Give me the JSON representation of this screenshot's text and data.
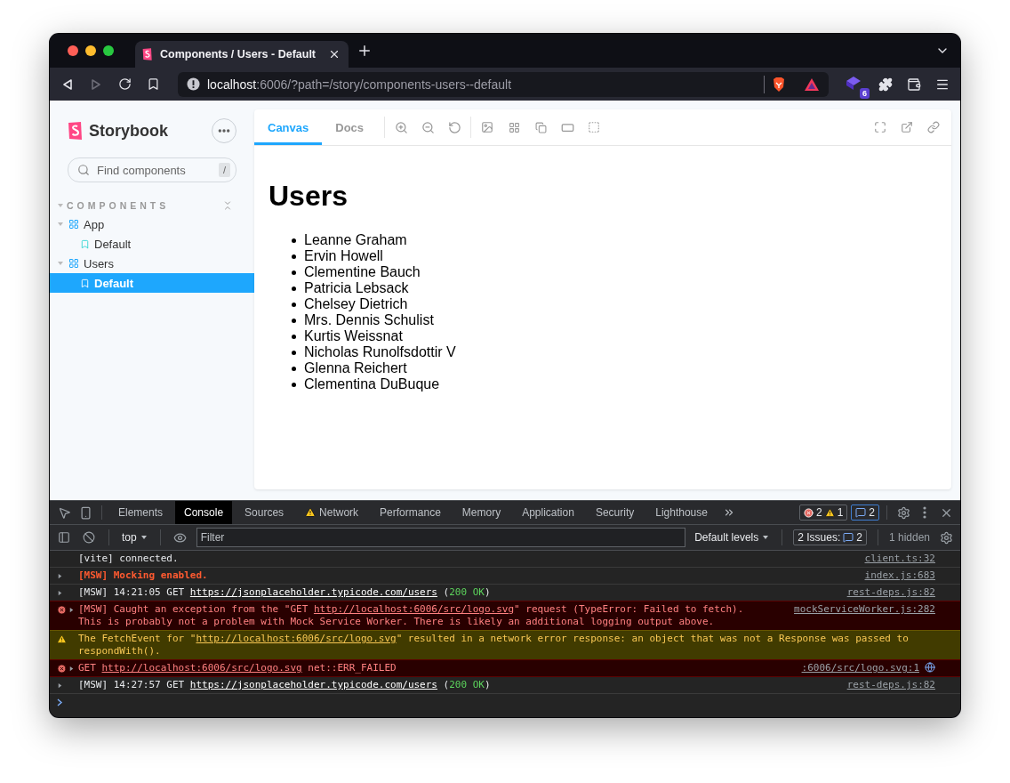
{
  "browser": {
    "tab": {
      "title": "Components / Users - Default"
    },
    "address": {
      "host": "localhost",
      "path": ":6006/?path=/story/components-users--default"
    },
    "extension_badge": "6"
  },
  "storybook": {
    "brand": "Storybook",
    "search": {
      "placeholder": "Find components",
      "shortcut": "/"
    },
    "section": "COMPONENTS",
    "tree": [
      {
        "label": "App",
        "expanded": true,
        "selected": false,
        "children": [
          {
            "label": "Default",
            "selected": false
          }
        ]
      },
      {
        "label": "Users",
        "expanded": true,
        "selected": false,
        "children": [
          {
            "label": "Default",
            "selected": true
          }
        ]
      }
    ],
    "toolbar_tabs": [
      {
        "label": "Canvas",
        "selected": true
      },
      {
        "label": "Docs",
        "selected": false
      }
    ],
    "canvas": {
      "heading": "Users",
      "items": [
        "Leanne Graham",
        "Ervin Howell",
        "Clementine Bauch",
        "Patricia Lebsack",
        "Chelsey Dietrich",
        "Mrs. Dennis Schulist",
        "Kurtis Weissnat",
        "Nicholas Runolfsdottir V",
        "Glenna Reichert",
        "Clementina DuBuque"
      ]
    }
  },
  "devtools": {
    "tabs": [
      {
        "label": "Elements",
        "selected": false,
        "warning": false
      },
      {
        "label": "Console",
        "selected": true,
        "warning": false
      },
      {
        "label": "Sources",
        "selected": false,
        "warning": false
      },
      {
        "label": "Network",
        "selected": false,
        "warning": true
      },
      {
        "label": "Performance",
        "selected": false,
        "warning": false
      },
      {
        "label": "Memory",
        "selected": false,
        "warning": false
      },
      {
        "label": "Application",
        "selected": false,
        "warning": false
      },
      {
        "label": "Security",
        "selected": false,
        "warning": false
      },
      {
        "label": "Lighthouse",
        "selected": false,
        "warning": false
      }
    ],
    "counts": {
      "errors": "2",
      "warnings": "1",
      "messages": "2"
    },
    "filter": {
      "context": "top",
      "placeholder": "Filter",
      "levels": "Default levels",
      "issues_label": "2 Issues:",
      "issues_count": "2",
      "hidden": "1 hidden"
    },
    "messages": [
      {
        "kind": "log",
        "expandable": false,
        "source_icon": false,
        "parts": [
          {
            "kind": "text",
            "text": "[vite] connected."
          }
        ],
        "source": "client.ts:32"
      },
      {
        "kind": "notice",
        "expandable": true,
        "source_icon": false,
        "parts": [
          {
            "kind": "text",
            "text": "[MSW] Mocking enabled."
          }
        ],
        "source": "index.js:683"
      },
      {
        "kind": "log",
        "expandable": true,
        "source_icon": false,
        "parts": [
          {
            "kind": "text",
            "text": "[MSW] 14:21:05 GET "
          },
          {
            "kind": "link",
            "text": "https://jsonplaceholder.typicode.com/users"
          },
          {
            "kind": "text",
            "text": " ("
          },
          {
            "kind": "status",
            "text": "200 OK"
          },
          {
            "kind": "text",
            "text": ")"
          }
        ],
        "source": "rest-deps.js:82"
      },
      {
        "kind": "error",
        "expandable": true,
        "source_icon": false,
        "parts": [
          {
            "kind": "text",
            "text": "[MSW] Caught an exception from the \"GET "
          },
          {
            "kind": "link",
            "text": "http://localhost:6006/src/logo.svg"
          },
          {
            "kind": "text",
            "text": "\" request (TypeError: Failed to fetch). This is probably not a problem with Mock Service Worker. There is likely an additional logging output above."
          }
        ],
        "source": "mockServiceWorker.js:282"
      },
      {
        "kind": "warning",
        "expandable": false,
        "source_icon": false,
        "parts": [
          {
            "kind": "text",
            "text": "The FetchEvent for \""
          },
          {
            "kind": "link",
            "text": "http://localhost:6006/src/logo.svg"
          },
          {
            "kind": "text",
            "text": "\" resulted in a network error response: an object that was not a Response was passed to respondWith()."
          }
        ]
      },
      {
        "kind": "error",
        "expandable": true,
        "source_icon": true,
        "parts": [
          {
            "kind": "text",
            "text": "GET "
          },
          {
            "kind": "link",
            "text": "http://localhost:6006/src/logo.svg"
          },
          {
            "kind": "text",
            "text": " net::ERR_FAILED"
          }
        ],
        "source": ":6006/src/logo.svg:1"
      },
      {
        "kind": "log",
        "expandable": true,
        "source_icon": false,
        "parts": [
          {
            "kind": "text",
            "text": "[MSW] 14:27:57 GET "
          },
          {
            "kind": "link",
            "text": "https://jsonplaceholder.typicode.com/users"
          },
          {
            "kind": "text",
            "text": " ("
          },
          {
            "kind": "status",
            "text": "200 OK"
          },
          {
            "kind": "text",
            "text": ")"
          }
        ],
        "source": "rest-deps.js:82"
      }
    ]
  }
}
